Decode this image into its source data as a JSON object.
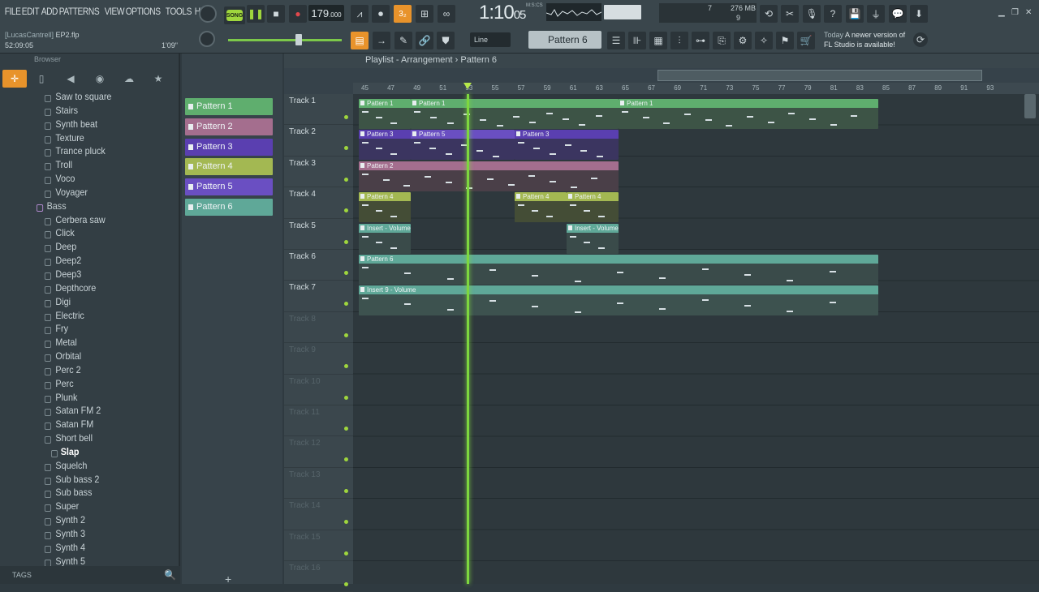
{
  "menu": [
    "FILE",
    "EDIT",
    "ADD",
    "PATTERNS",
    "VIEW",
    "OPTIONS",
    "TOOLS",
    "HELP"
  ],
  "project": {
    "user": "[LucasCantrell]",
    "file": "EP2.flp",
    "time": "52:09:05",
    "length": "1'09\""
  },
  "transport": {
    "song_label": "SONG",
    "tempo": "179",
    "tempo_dec": ".000",
    "time_main": "1:10",
    "time_sub": "05",
    "time_unit": "M:S:CS"
  },
  "cpu": {
    "voices": "7",
    "mem": "276 MB",
    "poly": "9"
  },
  "snap": {
    "label": "Line"
  },
  "pattern_select": {
    "label": "Pattern 6"
  },
  "news": {
    "when": "Today",
    "line1": "A newer version of",
    "line2": "FL Studio is available!"
  },
  "browser": {
    "header": "Browser",
    "items": [
      {
        "label": "Saw to square",
        "type": "preset"
      },
      {
        "label": "Stairs",
        "type": "preset"
      },
      {
        "label": "Synth beat",
        "type": "preset"
      },
      {
        "label": "Texture",
        "type": "preset"
      },
      {
        "label": "Trance pluck",
        "type": "preset"
      },
      {
        "label": "Troll",
        "type": "preset"
      },
      {
        "label": "Voco",
        "type": "preset"
      },
      {
        "label": "Voyager",
        "type": "preset"
      },
      {
        "label": "Bass",
        "type": "folder"
      },
      {
        "label": "Cerbera saw",
        "type": "preset"
      },
      {
        "label": "Click",
        "type": "preset"
      },
      {
        "label": "Deep",
        "type": "preset"
      },
      {
        "label": "Deep2",
        "type": "preset"
      },
      {
        "label": "Deep3",
        "type": "preset"
      },
      {
        "label": "Depthcore",
        "type": "preset"
      },
      {
        "label": "Digi",
        "type": "preset"
      },
      {
        "label": "Electric",
        "type": "preset"
      },
      {
        "label": "Fry",
        "type": "preset"
      },
      {
        "label": "Metal",
        "type": "preset"
      },
      {
        "label": "Orbital",
        "type": "preset"
      },
      {
        "label": "Perc 2",
        "type": "preset"
      },
      {
        "label": "Perc",
        "type": "preset"
      },
      {
        "label": "Plunk",
        "type": "preset"
      },
      {
        "label": "Satan FM 2",
        "type": "preset"
      },
      {
        "label": "Satan FM",
        "type": "preset"
      },
      {
        "label": "Short bell",
        "type": "preset"
      },
      {
        "label": "Slap",
        "type": "selected"
      },
      {
        "label": "Squelch",
        "type": "preset"
      },
      {
        "label": "Sub bass 2",
        "type": "preset"
      },
      {
        "label": "Sub bass",
        "type": "preset"
      },
      {
        "label": "Super",
        "type": "preset"
      },
      {
        "label": "Synth 2",
        "type": "preset"
      },
      {
        "label": "Synth 3",
        "type": "preset"
      },
      {
        "label": "Synth 4",
        "type": "preset"
      },
      {
        "label": "Synth 5",
        "type": "preset"
      }
    ],
    "tags_label": "TAGS"
  },
  "patterns": [
    {
      "label": "Pattern 1",
      "color": "#5fae6e"
    },
    {
      "label": "Pattern 2",
      "color": "#a46e8e"
    },
    {
      "label": "Pattern 3",
      "color": "#5a3fb0"
    },
    {
      "label": "Pattern 4",
      "color": "#a3b852"
    },
    {
      "label": "Pattern 5",
      "color": "#6a4fc2"
    },
    {
      "label": "Pattern 6",
      "color": "#5fa898"
    }
  ],
  "playlist": {
    "breadcrumb": "Playlist - Arrangement › Pattern 6",
    "bars": [
      "45",
      "47",
      "49",
      "51",
      "53",
      "55",
      "57",
      "59",
      "61",
      "63",
      "65",
      "67",
      "69",
      "71",
      "73",
      "75",
      "77",
      "79",
      "81",
      "83",
      "85",
      "87",
      "89",
      "91",
      "93"
    ],
    "tracks": [
      "Track 1",
      "Track 2",
      "Track 3",
      "Track 4",
      "Track 5",
      "Track 6",
      "Track 7",
      "Track 8",
      "Track 9",
      "Track 10",
      "Track 11",
      "Track 12",
      "Track 13",
      "Track 14",
      "Track 15",
      "Track 16"
    ],
    "clip_labels": {
      "p1": "Pattern 1",
      "p2": "Pattern 2",
      "p3": "Pattern 3",
      "p4": "Pattern 4",
      "p5": "Pattern 5",
      "p6": "Pattern 6",
      "auto_vol": "Insert - Volume",
      "auto_ins9": "Insert 9 - Volume"
    }
  },
  "colors": {
    "accent": "#e8932b",
    "playhead": "#7ed73f",
    "song_led": "#9fd63d"
  }
}
